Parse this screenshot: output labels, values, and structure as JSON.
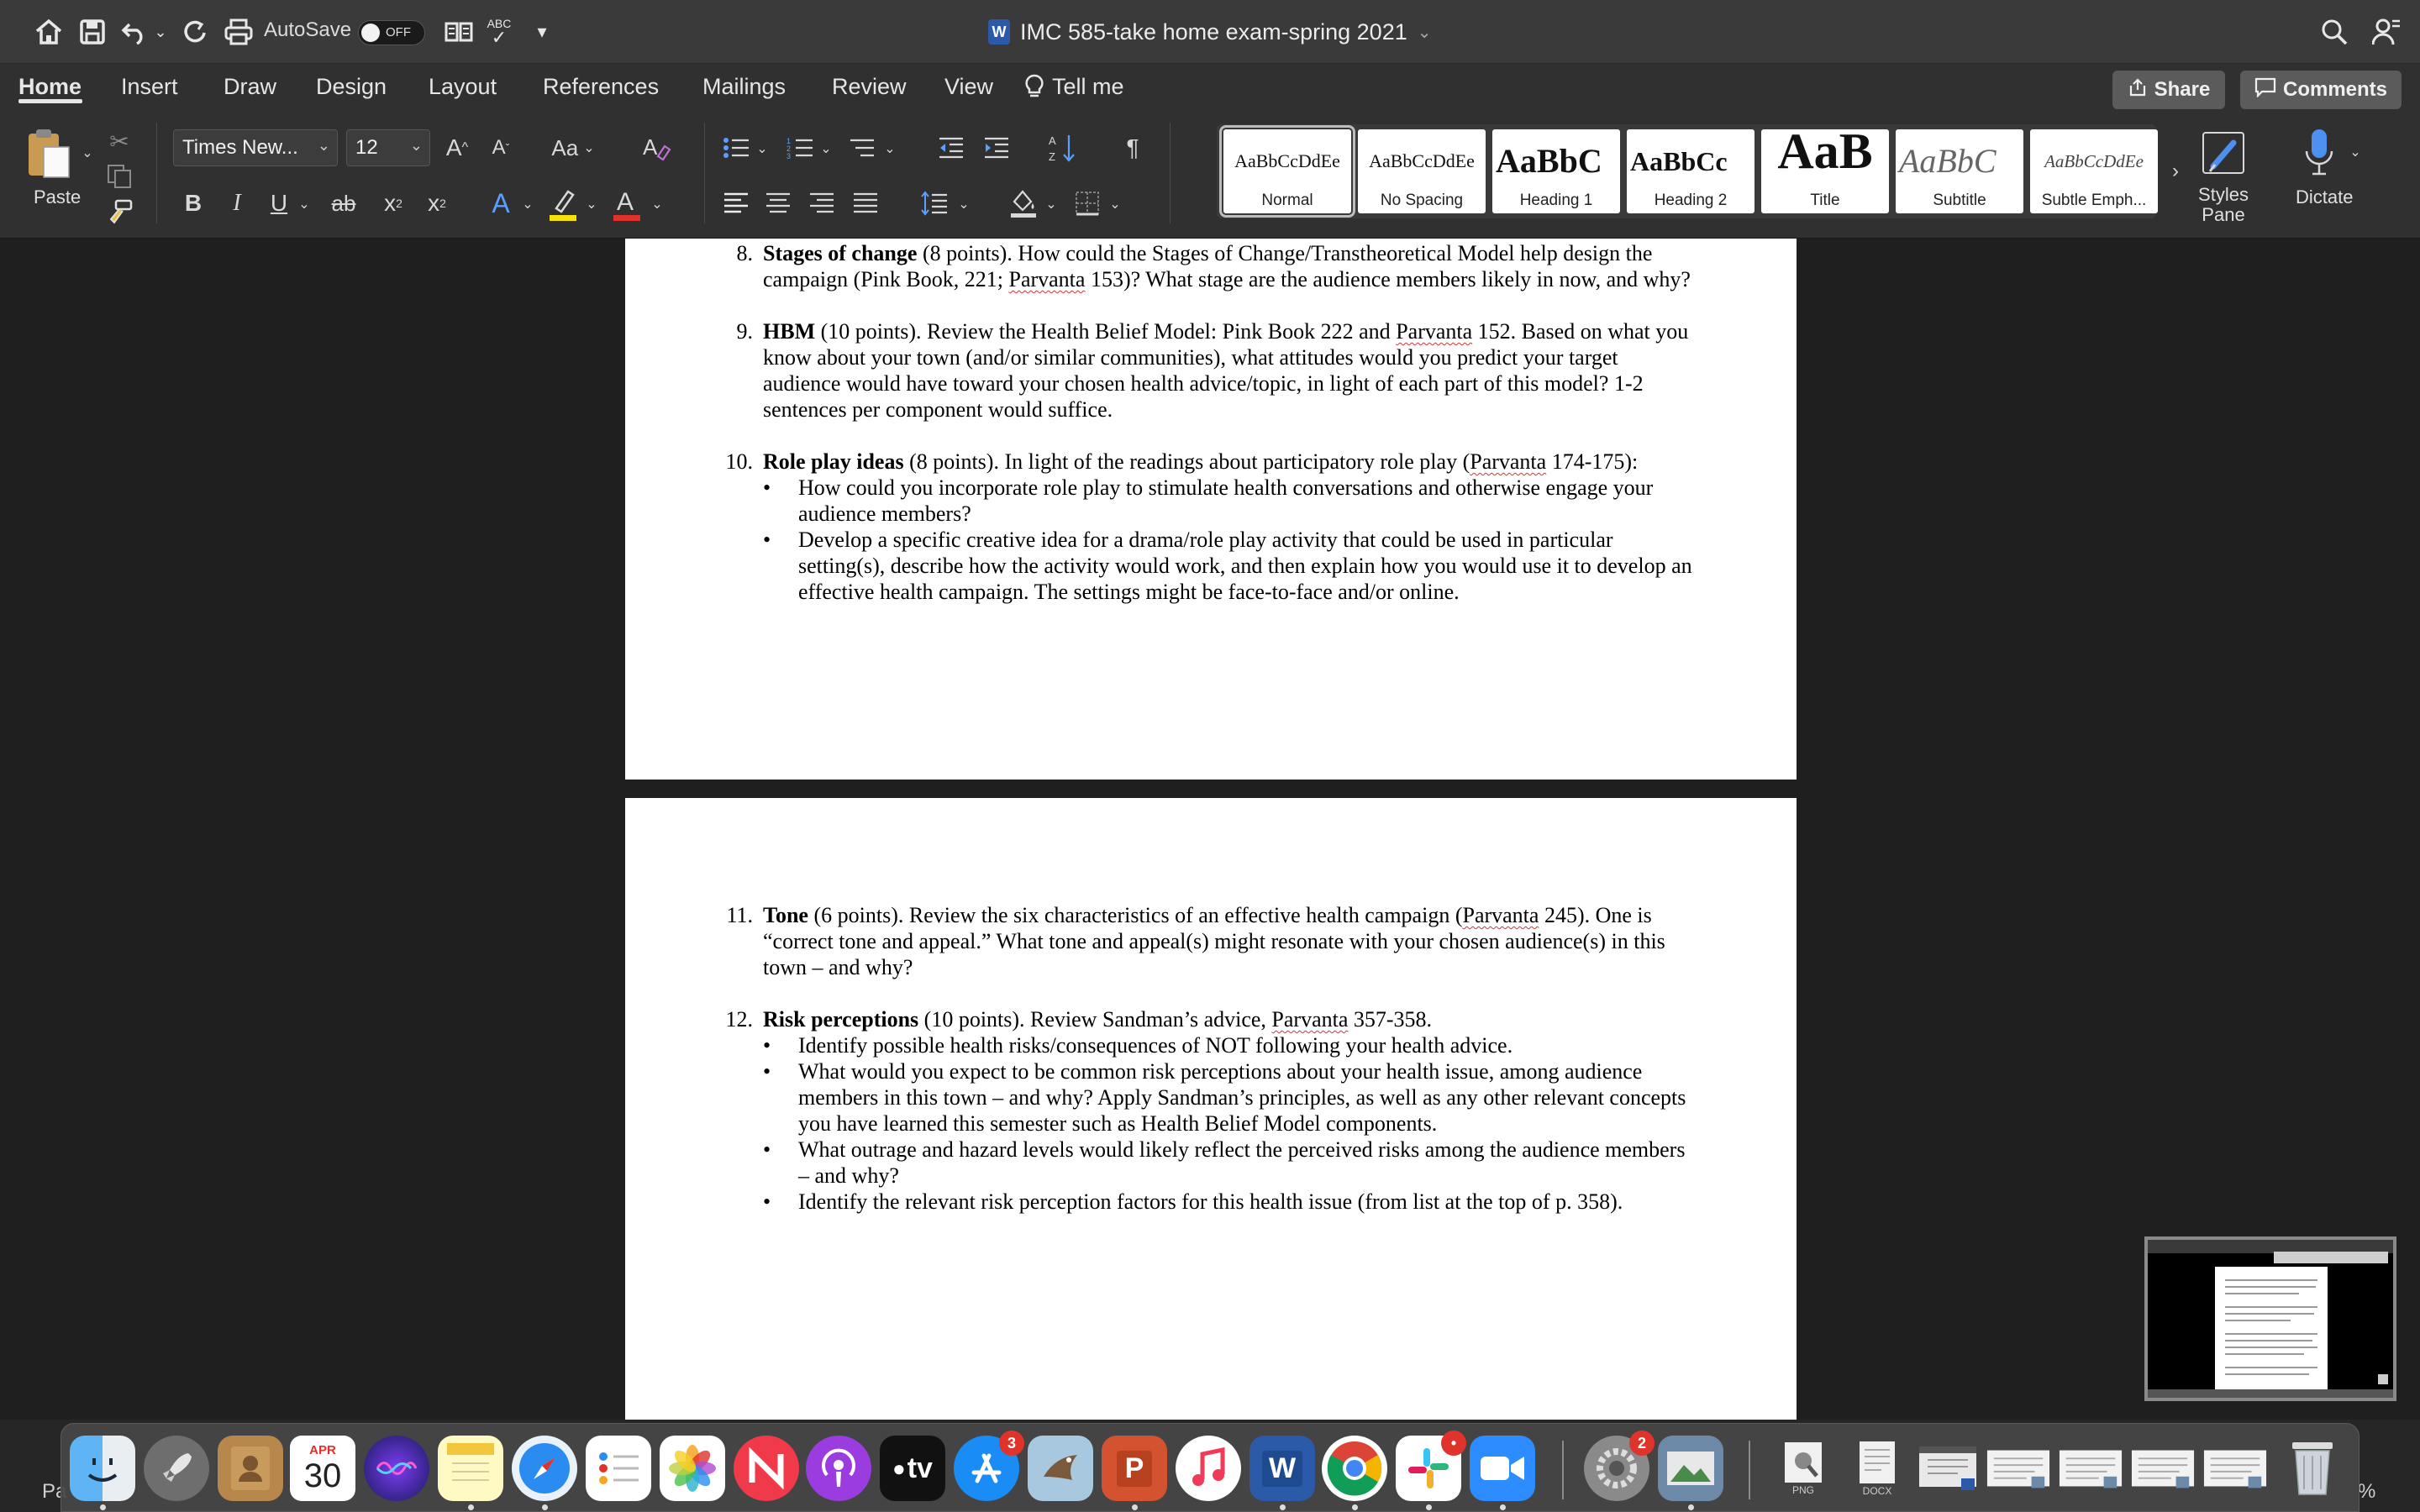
{
  "titlebar": {
    "autosave_label": "AutoSave",
    "autosave_state": "OFF",
    "spell_badge": "ABC",
    "doc_title": "IMC 585-take home exam-spring 2021",
    "word_icon_letter": "W"
  },
  "tabs": [
    {
      "label": "Home",
      "active": true
    },
    {
      "label": "Insert"
    },
    {
      "label": "Draw"
    },
    {
      "label": "Design"
    },
    {
      "label": "Layout"
    },
    {
      "label": "References"
    },
    {
      "label": "Mailings"
    },
    {
      "label": "Review"
    },
    {
      "label": "View"
    },
    {
      "label": "Tell me"
    }
  ],
  "share_label": "Share",
  "comments_label": "Comments",
  "ribbon": {
    "paste_label": "Paste",
    "font_name": "Times New...",
    "font_size": "12",
    "case_label": "Aa",
    "bold": "B",
    "italic": "I",
    "underline": "U",
    "strike": "ab",
    "subscript": "x",
    "superscript": "x",
    "pilcrow": "¶",
    "styles_pane_label": "Styles Pane",
    "dictate_label": "Dictate",
    "highlight_color": "#f4e00a",
    "font_color": "#e0312b"
  },
  "styles": [
    {
      "sample": "AaBbCcDdEe",
      "name": "Normal",
      "selected": true
    },
    {
      "sample": "AaBbCcDdEe",
      "name": "No Spacing"
    },
    {
      "sample": "AaBbC",
      "name": "Heading 1"
    },
    {
      "sample": "AaBbCc",
      "name": "Heading 2"
    },
    {
      "sample": "AaB",
      "name": "Title"
    },
    {
      "sample": "AaBbC",
      "name": "Subtitle"
    },
    {
      "sample": "AaBbCcDdEe",
      "name": "Subtle Emph..."
    }
  ],
  "document": {
    "page1": [
      {
        "num": "8.",
        "title": "Stages of change",
        "text": " (8 points). How could the Stages of Change/Transtheoretical Model help design the campaign (Pink Book, 221; ",
        "sq": "Parvanta",
        "text2": " 153)? What stage are the audience members likely in now, and why?"
      },
      {
        "num": "9.",
        "title": "HBM",
        "text": " (10 points). Review the Health Belief Model: Pink Book 222 and ",
        "sq": "Parvanta",
        "text2": " 152. Based on what you know about your town (and/or similar communities), what attitudes would you predict your target audience would have toward your chosen health advice/topic, in light of each part of this model? 1-2 sentences per component would suffice."
      },
      {
        "num": "10.",
        "title": "Role play ideas",
        "text": " (8 points). In light of the readings about participatory role play (",
        "sq": "Parvanta",
        "text2": " 174-175):",
        "bullets": [
          "How could you incorporate role play to stimulate health conversations and otherwise engage your audience members?",
          "Develop a specific creative idea for a drama/role play activity that could be used in particular setting(s), describe how the activity would work, and then explain how you would use it to develop an effective health campaign. The settings might be face-to-face and/or online."
        ]
      }
    ],
    "page2": [
      {
        "num": "11.",
        "title": "Tone",
        "text": " (6 points). Review the six characteristics of an effective health campaign (",
        "sq": "Parvanta",
        "text2": " 245). One is “correct tone and appeal.” What tone and appeal(s) might resonate with your chosen audience(s) in this town – and why?"
      },
      {
        "num": "12.",
        "title": "Risk perceptions",
        "text": " (10 points). Review Sandman’s advice, ",
        "sq": "Parvanta",
        "text2": " 357-358.",
        "bullets": [
          "Identify possible health risks/consequences of NOT following your health advice.",
          "What would you expect to be common risk perceptions about your health issue, among audience members in this town – and why? Apply Sandman’s principles, as well as any other relevant concepts you have learned this semester such as Health Belief Model components.",
          "What outrage and hazard levels would likely reflect the perceived risks among the audience members – and why?",
          "Identify the relevant risk perception factors for this health issue (from list at the top of p. 358)."
        ]
      }
    ]
  },
  "statusbar": {
    "left_fragment": "Pa",
    "right_fragment": "%"
  },
  "dock": {
    "calendar_month": "APR",
    "calendar_day": "30",
    "appstore_badge": "3",
    "slack_badge": "•",
    "settings_badge": "2",
    "tv_label": "tv",
    "word_letter": "W",
    "ppt_letter": "P",
    "png_label": "PNG",
    "docx_label": "DOCX"
  }
}
